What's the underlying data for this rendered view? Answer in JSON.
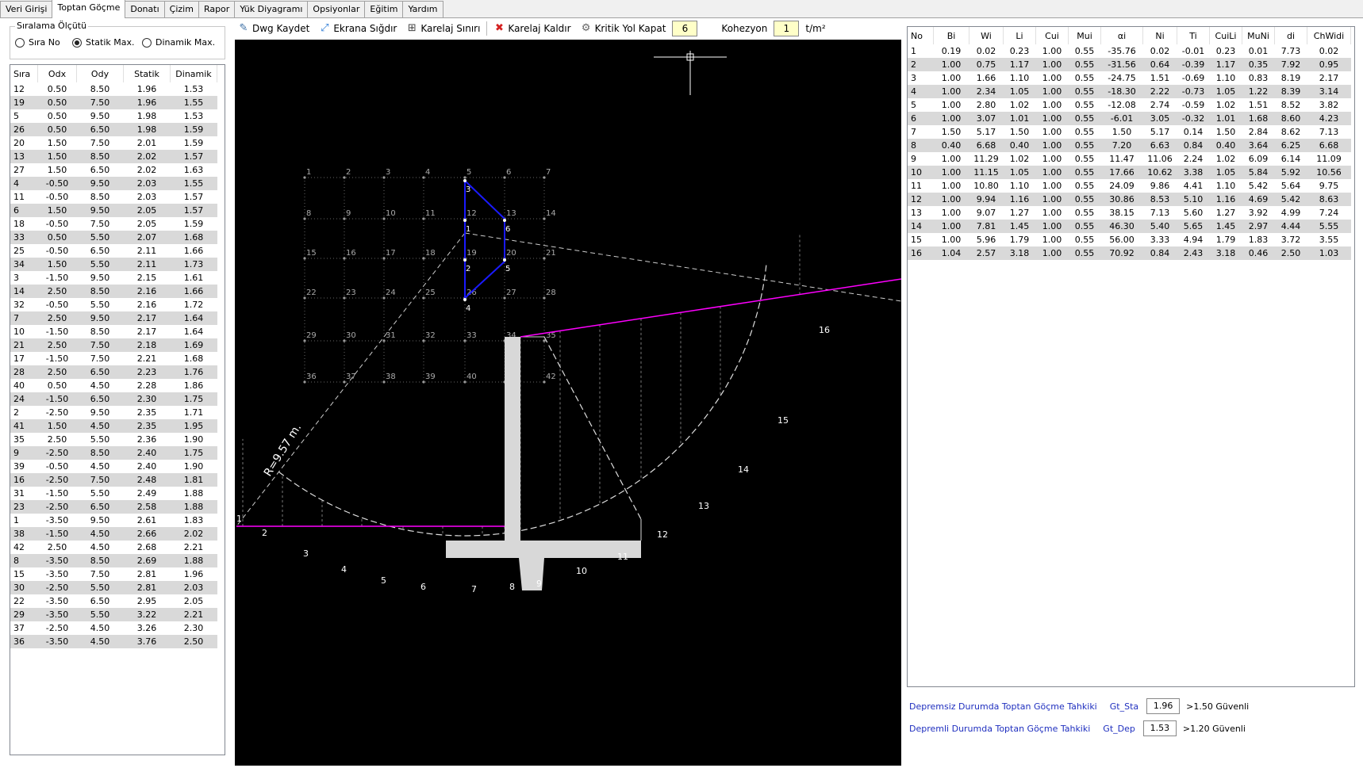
{
  "tabs": [
    "Veri Girişi",
    "Toptan Göçme",
    "Donatı",
    "Çizim",
    "Rapor",
    "Yük Diyagramı",
    "Opsiyonlar",
    "Eğitim",
    "Yardım"
  ],
  "active_tab": "Toptan Göçme",
  "sort": {
    "title": "Sıralama Ölçütü",
    "options": [
      "Sıra No",
      "Statik Max.",
      "Dinamik Max."
    ],
    "selected": "Statik Max."
  },
  "toolbar": {
    "dwg": "Dwg Kaydet",
    "fit": "Ekrana Sığdır",
    "grid": "Karelaj Sınırı",
    "remove": "Karelaj Kaldır",
    "critical": "Kritik Yol Kapat",
    "critical_val": "6",
    "kohezyon": "Kohezyon",
    "kohezyon_val": "1",
    "unit": "t/m²"
  },
  "left_table": {
    "headers": [
      "Sıra",
      "Odx",
      "Ody",
      "Statik",
      "Dinamik"
    ],
    "rows": [
      [
        "12",
        "0.50",
        "8.50",
        "1.96",
        "1.53"
      ],
      [
        "19",
        "0.50",
        "7.50",
        "1.96",
        "1.55"
      ],
      [
        "5",
        "0.50",
        "9.50",
        "1.98",
        "1.53"
      ],
      [
        "26",
        "0.50",
        "6.50",
        "1.98",
        "1.59"
      ],
      [
        "20",
        "1.50",
        "7.50",
        "2.01",
        "1.59"
      ],
      [
        "13",
        "1.50",
        "8.50",
        "2.02",
        "1.57"
      ],
      [
        "27",
        "1.50",
        "6.50",
        "2.02",
        "1.63"
      ],
      [
        "4",
        "-0.50",
        "9.50",
        "2.03",
        "1.55"
      ],
      [
        "11",
        "-0.50",
        "8.50",
        "2.03",
        "1.57"
      ],
      [
        "6",
        "1.50",
        "9.50",
        "2.05",
        "1.57"
      ],
      [
        "18",
        "-0.50",
        "7.50",
        "2.05",
        "1.59"
      ],
      [
        "33",
        "0.50",
        "5.50",
        "2.07",
        "1.68"
      ],
      [
        "25",
        "-0.50",
        "6.50",
        "2.11",
        "1.66"
      ],
      [
        "34",
        "1.50",
        "5.50",
        "2.11",
        "1.73"
      ],
      [
        "3",
        "-1.50",
        "9.50",
        "2.15",
        "1.61"
      ],
      [
        "14",
        "2.50",
        "8.50",
        "2.16",
        "1.66"
      ],
      [
        "32",
        "-0.50",
        "5.50",
        "2.16",
        "1.72"
      ],
      [
        "7",
        "2.50",
        "9.50",
        "2.17",
        "1.64"
      ],
      [
        "10",
        "-1.50",
        "8.50",
        "2.17",
        "1.64"
      ],
      [
        "21",
        "2.50",
        "7.50",
        "2.18",
        "1.69"
      ],
      [
        "17",
        "-1.50",
        "7.50",
        "2.21",
        "1.68"
      ],
      [
        "28",
        "2.50",
        "6.50",
        "2.23",
        "1.76"
      ],
      [
        "40",
        "0.50",
        "4.50",
        "2.28",
        "1.86"
      ],
      [
        "24",
        "-1.50",
        "6.50",
        "2.30",
        "1.75"
      ],
      [
        "2",
        "-2.50",
        "9.50",
        "2.35",
        "1.71"
      ],
      [
        "41",
        "1.50",
        "4.50",
        "2.35",
        "1.95"
      ],
      [
        "35",
        "2.50",
        "5.50",
        "2.36",
        "1.90"
      ],
      [
        "9",
        "-2.50",
        "8.50",
        "2.40",
        "1.75"
      ],
      [
        "39",
        "-0.50",
        "4.50",
        "2.40",
        "1.90"
      ],
      [
        "16",
        "-2.50",
        "7.50",
        "2.48",
        "1.81"
      ],
      [
        "31",
        "-1.50",
        "5.50",
        "2.49",
        "1.88"
      ],
      [
        "23",
        "-2.50",
        "6.50",
        "2.58",
        "1.88"
      ],
      [
        "1",
        "-3.50",
        "9.50",
        "2.61",
        "1.83"
      ],
      [
        "38",
        "-1.50",
        "4.50",
        "2.66",
        "2.02"
      ],
      [
        "42",
        "2.50",
        "4.50",
        "2.68",
        "2.21"
      ],
      [
        "8",
        "-3.50",
        "8.50",
        "2.69",
        "1.88"
      ],
      [
        "15",
        "-3.50",
        "7.50",
        "2.81",
        "1.96"
      ],
      [
        "30",
        "-2.50",
        "5.50",
        "2.81",
        "2.03"
      ],
      [
        "22",
        "-3.50",
        "6.50",
        "2.95",
        "2.05"
      ],
      [
        "29",
        "-3.50",
        "5.50",
        "3.22",
        "2.21"
      ],
      [
        "37",
        "-2.50",
        "4.50",
        "3.26",
        "2.30"
      ],
      [
        "36",
        "-3.50",
        "4.50",
        "3.76",
        "2.50"
      ]
    ]
  },
  "right_table": {
    "headers": [
      "No",
      "Bi",
      "Wi",
      "Li",
      "Cui",
      "Mui",
      "αi",
      "Ni",
      "Ti",
      "CuiLi",
      "MuNi",
      "di",
      "ChWidi"
    ],
    "rows": [
      [
        "1",
        "0.19",
        "0.02",
        "0.23",
        "1.00",
        "0.55",
        "-35.76",
        "0.02",
        "-0.01",
        "0.23",
        "0.01",
        "7.73",
        "0.02"
      ],
      [
        "2",
        "1.00",
        "0.75",
        "1.17",
        "1.00",
        "0.55",
        "-31.56",
        "0.64",
        "-0.39",
        "1.17",
        "0.35",
        "7.92",
        "0.95"
      ],
      [
        "3",
        "1.00",
        "1.66",
        "1.10",
        "1.00",
        "0.55",
        "-24.75",
        "1.51",
        "-0.69",
        "1.10",
        "0.83",
        "8.19",
        "2.17"
      ],
      [
        "4",
        "1.00",
        "2.34",
        "1.05",
        "1.00",
        "0.55",
        "-18.30",
        "2.22",
        "-0.73",
        "1.05",
        "1.22",
        "8.39",
        "3.14"
      ],
      [
        "5",
        "1.00",
        "2.80",
        "1.02",
        "1.00",
        "0.55",
        "-12.08",
        "2.74",
        "-0.59",
        "1.02",
        "1.51",
        "8.52",
        "3.82"
      ],
      [
        "6",
        "1.00",
        "3.07",
        "1.01",
        "1.00",
        "0.55",
        "-6.01",
        "3.05",
        "-0.32",
        "1.01",
        "1.68",
        "8.60",
        "4.23"
      ],
      [
        "7",
        "1.50",
        "5.17",
        "1.50",
        "1.00",
        "0.55",
        "1.50",
        "5.17",
        "0.14",
        "1.50",
        "2.84",
        "8.62",
        "7.13"
      ],
      [
        "8",
        "0.40",
        "6.68",
        "0.40",
        "1.00",
        "0.55",
        "7.20",
        "6.63",
        "0.84",
        "0.40",
        "3.64",
        "6.25",
        "6.68"
      ],
      [
        "9",
        "1.00",
        "11.29",
        "1.02",
        "1.00",
        "0.55",
        "11.47",
        "11.06",
        "2.24",
        "1.02",
        "6.09",
        "6.14",
        "11.09"
      ],
      [
        "10",
        "1.00",
        "11.15",
        "1.05",
        "1.00",
        "0.55",
        "17.66",
        "10.62",
        "3.38",
        "1.05",
        "5.84",
        "5.92",
        "10.56"
      ],
      [
        "11",
        "1.00",
        "10.80",
        "1.10",
        "1.00",
        "0.55",
        "24.09",
        "9.86",
        "4.41",
        "1.10",
        "5.42",
        "5.64",
        "9.75"
      ],
      [
        "12",
        "1.00",
        "9.94",
        "1.16",
        "1.00",
        "0.55",
        "30.86",
        "8.53",
        "5.10",
        "1.16",
        "4.69",
        "5.42",
        "8.63"
      ],
      [
        "13",
        "1.00",
        "9.07",
        "1.27",
        "1.00",
        "0.55",
        "38.15",
        "7.13",
        "5.60",
        "1.27",
        "3.92",
        "4.99",
        "7.24"
      ],
      [
        "14",
        "1.00",
        "7.81",
        "1.45",
        "1.00",
        "0.55",
        "46.30",
        "5.40",
        "5.65",
        "1.45",
        "2.97",
        "4.44",
        "5.55"
      ],
      [
        "15",
        "1.00",
        "5.96",
        "1.79",
        "1.00",
        "0.55",
        "56.00",
        "3.33",
        "4.94",
        "1.79",
        "1.83",
        "3.72",
        "3.55"
      ],
      [
        "16",
        "1.04",
        "2.57",
        "3.18",
        "1.00",
        "0.55",
        "70.92",
        "0.84",
        "2.43",
        "3.18",
        "0.46",
        "2.50",
        "1.03"
      ]
    ]
  },
  "checks": [
    {
      "label": "Depremsiz Durumda Toptan Göçme Tahkiki",
      "gt": "Gt_Sta",
      "value": "1.96",
      "result": ">1.50 Güvenli"
    },
    {
      "label": "Depremli Durumda Toptan Göçme Tahkiki",
      "gt": "Gt_Dep",
      "value": "1.53",
      "result": ">1.20 Güvenli"
    }
  ],
  "drawing": {
    "radius_label": "R=9.57 m.",
    "slices": [
      "1",
      "2",
      "3",
      "4",
      "5",
      "6",
      "7",
      "8",
      "9",
      "10",
      "11",
      "12",
      "13",
      "14",
      "15",
      "16"
    ],
    "path_points": [
      "1",
      "2",
      "3",
      "4",
      "5",
      "6"
    ]
  },
  "colors": {
    "surface": "#ff00ff",
    "path": "#0000ff",
    "wall": "#d8d8d8",
    "canvas": "#000000"
  }
}
